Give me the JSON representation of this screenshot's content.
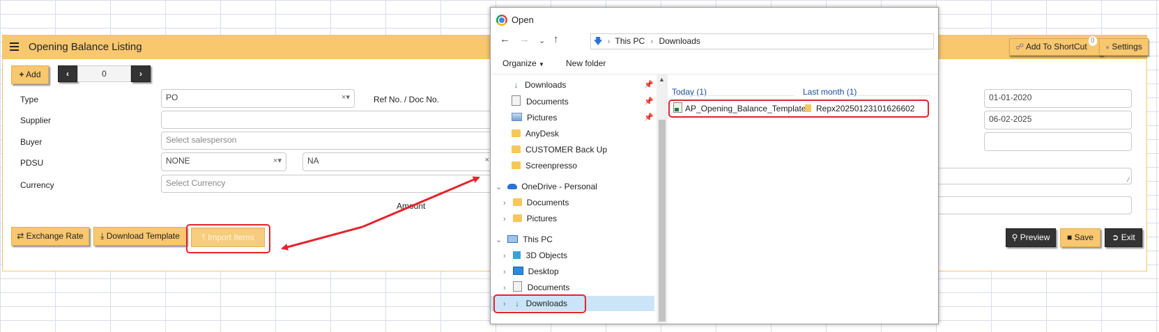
{
  "app": {
    "title": "Opening Balance Listing",
    "header_buttons": {
      "shortcut_label": "Add To ShortCut",
      "shortcut_count": "0",
      "settings_label": "Settings"
    },
    "toolbar": {
      "add_label": "Add",
      "pager_value": "0"
    },
    "fields": {
      "type": {
        "label": "Type",
        "value": "PO",
        "clear": "×"
      },
      "ref_label": "Ref No. / Doc No.",
      "supplier": {
        "label": "Supplier",
        "value": ""
      },
      "buyer": {
        "label": "Buyer",
        "placeholder": "Select salesperson"
      },
      "pdsu": {
        "label": "PDSU",
        "value": "NONE",
        "value2": "NA",
        "clear": "×"
      },
      "currency": {
        "label": "Currency",
        "placeholder": "Select Currency"
      },
      "amount_label": "Amount",
      "date1": "01-01-2020",
      "date2": "06-02-2025"
    },
    "bottom_buttons": {
      "exchange_rate": "Exchange Rate",
      "download_template": "Download Template",
      "import_items": "Import Items",
      "preview": "Preview",
      "save": "Save",
      "exit": "Exit"
    }
  },
  "dialog": {
    "title": "Open",
    "breadcrumb": [
      "This PC",
      "Downloads"
    ],
    "organize_label": "Organize",
    "new_folder_label": "New folder",
    "quick_access": [
      {
        "label": "Downloads",
        "icon": "download-icon",
        "pinned": true
      },
      {
        "label": "Documents",
        "icon": "document-icon",
        "pinned": true
      },
      {
        "label": "Pictures",
        "icon": "pictures-icon",
        "pinned": true
      },
      {
        "label": "AnyDesk",
        "icon": "folder-icon"
      },
      {
        "label": "CUSTOMER Back Up",
        "icon": "folder-icon"
      },
      {
        "label": "Screenpresso",
        "icon": "folder-icon"
      }
    ],
    "onedrive": {
      "label": "OneDrive - Personal",
      "children": [
        "Documents",
        "Pictures"
      ]
    },
    "this_pc": {
      "label": "This PC",
      "children": [
        "3D Objects",
        "Desktop",
        "Documents",
        "Downloads"
      ]
    },
    "groups": {
      "today": "Today (1)",
      "last_month": "Last month (1)"
    },
    "files": {
      "today": "AP_Opening_Balance_Template",
      "last_month": "Repx20250123101626602"
    }
  },
  "colors": {
    "accent": "#f8c76e",
    "highlight": "#e3242b",
    "dark_button": "#333333",
    "selection": "#cce4f7"
  }
}
